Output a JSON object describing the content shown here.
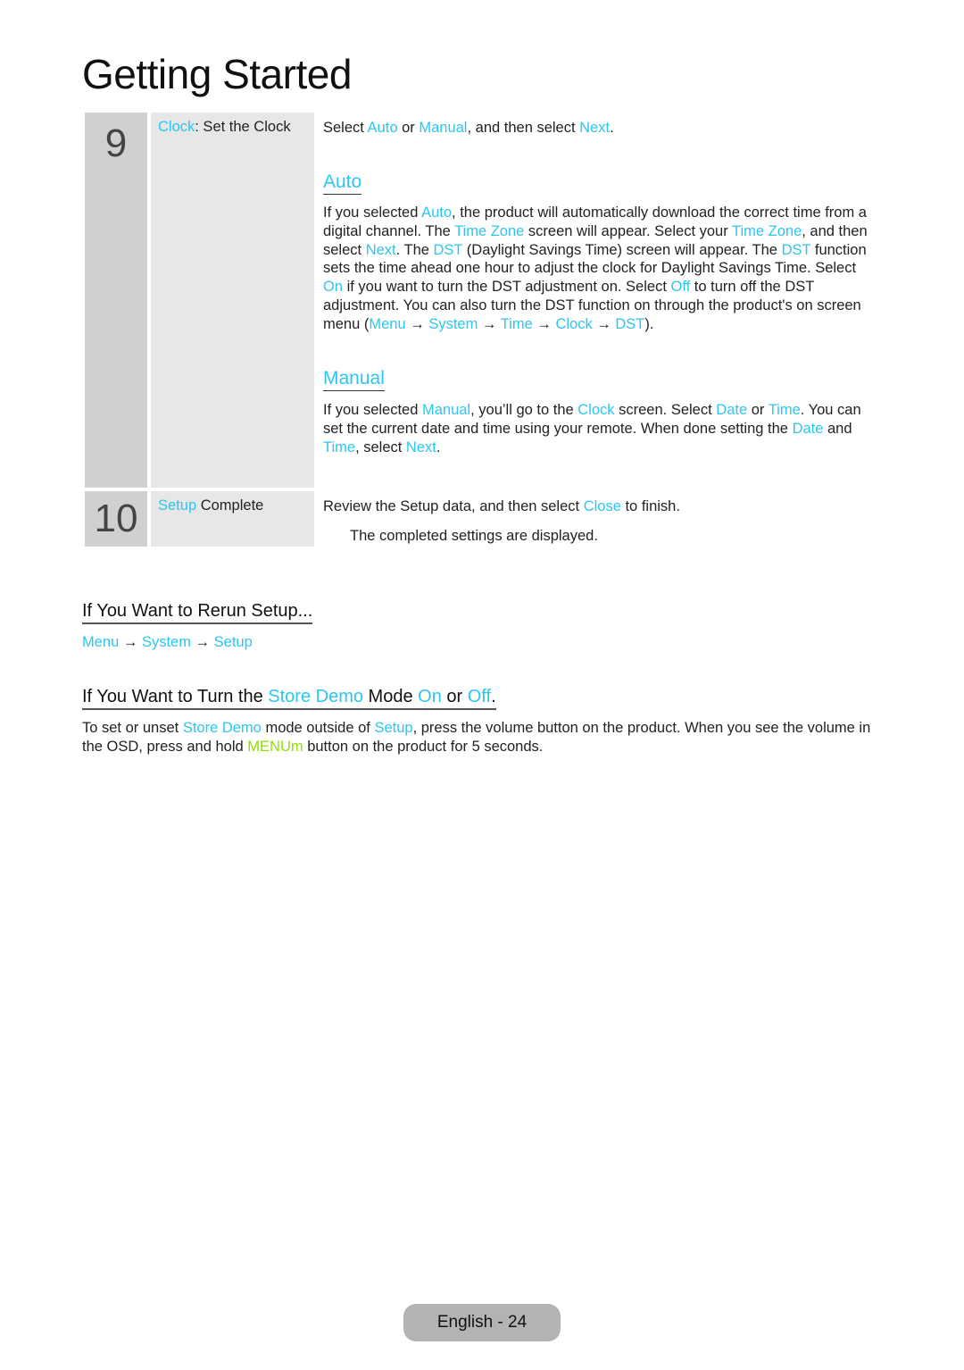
{
  "page": {
    "title": "Getting Started",
    "footer": "English - 24"
  },
  "colors": {
    "highlight": "#2cc6f0",
    "highlight_green": "#8ee000",
    "step_number_bg": "#d0d0d0",
    "step_label_bg": "#e7e7e7"
  },
  "steps": [
    {
      "number": "9",
      "label_hl": "Clock",
      "label_rest": ": Set the Clock",
      "intro": [
        {
          "t": "Select "
        },
        {
          "t": "Auto",
          "h": 1
        },
        {
          "t": " or "
        },
        {
          "t": "Manual",
          "h": 1
        },
        {
          "t": ", and then select "
        },
        {
          "t": "Next",
          "h": 1
        },
        {
          "t": "."
        }
      ],
      "auto_heading": "Auto",
      "auto_text": [
        {
          "t": "If you selected "
        },
        {
          "t": "Auto",
          "h": 1
        },
        {
          "t": ", the product will automatically download the correct time from a digital channel. The "
        },
        {
          "t": "Time Zone",
          "h": 1
        },
        {
          "t": " screen will appear. Select your "
        },
        {
          "t": "Time Zone",
          "h": 1
        },
        {
          "t": ", and then select "
        },
        {
          "t": "Next",
          "h": 1
        },
        {
          "t": ". The "
        },
        {
          "t": "DST",
          "h": 1
        },
        {
          "t": " (Daylight Savings Time) screen will appear. The "
        },
        {
          "t": "DST",
          "h": 1
        },
        {
          "t": " function sets the time ahead one hour to adjust the clock for Daylight Savings Time. Select "
        },
        {
          "t": "On",
          "h": 1
        },
        {
          "t": " if you want to turn the DST adjustment on. Select "
        },
        {
          "t": "Off",
          "h": 1
        },
        {
          "t": " to turn off the DST adjustment. You can also turn the DST function on through the product's on screen menu ("
        },
        {
          "t": "Menu",
          "h": 1
        },
        {
          "t": " → "
        },
        {
          "t": "System",
          "h": 1
        },
        {
          "t": " → "
        },
        {
          "t": "Time",
          "h": 1
        },
        {
          "t": " → "
        },
        {
          "t": "Clock",
          "h": 1
        },
        {
          "t": " → "
        },
        {
          "t": "DST",
          "h": 1
        },
        {
          "t": ")."
        }
      ],
      "manual_heading": "Manual",
      "manual_text": [
        {
          "t": "If you selected "
        },
        {
          "t": "Manual",
          "h": 1
        },
        {
          "t": ", you’ll go to the "
        },
        {
          "t": "Clock",
          "h": 1
        },
        {
          "t": " screen. Select "
        },
        {
          "t": "Date",
          "h": 1
        },
        {
          "t": " or "
        },
        {
          "t": "Time",
          "h": 1
        },
        {
          "t": ". You can set the current date and time using your remote. When done setting the "
        },
        {
          "t": "Date",
          "h": 1
        },
        {
          "t": " and "
        },
        {
          "t": "Time",
          "h": 1
        },
        {
          "t": ", select "
        },
        {
          "t": "Next",
          "h": 1
        },
        {
          "t": "."
        }
      ]
    },
    {
      "number": "10",
      "label_hl": "Setup",
      "label_rest": " Complete",
      "intro": [
        {
          "t": "Review the Setup data, and then select "
        },
        {
          "t": "Close",
          "h": 1
        },
        {
          "t": " to finish."
        }
      ],
      "note": "The completed settings are displayed."
    }
  ],
  "rerun": {
    "heading": "If You Want to Rerun Setup...",
    "path": [
      {
        "t": "Menu",
        "h": 1
      },
      {
        "t": " → "
      },
      {
        "t": "System",
        "h": 1
      },
      {
        "t": " → "
      },
      {
        "t": "Setup",
        "h": 1
      }
    ]
  },
  "store_demo": {
    "heading": [
      {
        "t": "If You Want to Turn the "
      },
      {
        "t": "Store Demo",
        "h": 1
      },
      {
        "t": " Mode "
      },
      {
        "t": "On",
        "h": 1
      },
      {
        "t": " or "
      },
      {
        "t": "Off",
        "h": 1
      },
      {
        "t": "."
      }
    ],
    "text": [
      {
        "t": "To set or unset "
      },
      {
        "t": "Store Demo",
        "h": 1
      },
      {
        "t": " mode outside of "
      },
      {
        "t": "Setup",
        "h": 1
      },
      {
        "t": ", press the volume button on the product. When you see the volume in the OSD, press and hold "
      },
      {
        "t": "MENUm",
        "h": 2
      },
      {
        "t": " button on the product for 5 seconds."
      }
    ]
  }
}
